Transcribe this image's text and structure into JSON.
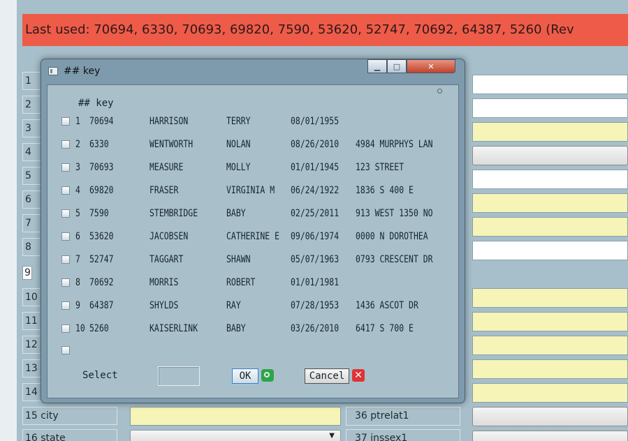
{
  "banner": {
    "text": "Last used: 70694, 6330, 70693, 69820, 7590, 53620, 52747, 70692, 64387, 5260 (Rev"
  },
  "left_rows": [
    "1",
    "2",
    "3",
    "4",
    "5",
    "6",
    "7",
    "8",
    "9",
    "10",
    "11",
    "12",
    "13",
    "14",
    "15 city",
    "16 state"
  ],
  "mid_rows": [
    "36 ptrelat1",
    "37 inssex1"
  ],
  "dialog": {
    "title": "## key",
    "header": "## key",
    "rows": [
      {
        "num": "1",
        "key": "70694",
        "last": "HARRISON",
        "first": "TERRY",
        "dob": "08/01/1955",
        "addr": ""
      },
      {
        "num": "2",
        "key": "6330",
        "last": "WENTWORTH",
        "first": "NOLAN",
        "dob": "08/26/2010",
        "addr": "4984 MURPHYS LAN"
      },
      {
        "num": "3",
        "key": "70693",
        "last": "MEASURE",
        "first": "MOLLY",
        "dob": "01/01/1945",
        "addr": "123 STREET"
      },
      {
        "num": "4",
        "key": "69820",
        "last": "FRASER",
        "first": "VIRGINIA M",
        "dob": "06/24/1922",
        "addr": "1836 S 400 E"
      },
      {
        "num": "5",
        "key": "7590",
        "last": "STEMBRIDGE",
        "first": "BABY",
        "dob": "02/25/2011",
        "addr": "913 WEST 1350 NO"
      },
      {
        "num": "6",
        "key": "53620",
        "last": "JACOBSEN",
        "first": "CATHERINE E",
        "dob": "09/06/1974",
        "addr": "0000 N DOROTHEA"
      },
      {
        "num": "7",
        "key": "52747",
        "last": "TAGGART",
        "first": "SHAWN",
        "dob": "05/07/1963",
        "addr": "0793 CRESCENT DR"
      },
      {
        "num": "8",
        "key": "70692",
        "last": "MORRIS",
        "first": "ROBERT",
        "dob": "01/01/1981",
        "addr": ""
      },
      {
        "num": "9",
        "key": "64387",
        "last": "SHYLDS",
        "first": "RAY",
        "dob": "07/28/1953",
        "addr": "1436 ASCOT DR"
      },
      {
        "num": "10",
        "key": "5260",
        "last": "KAISERLINK",
        "first": "BABY",
        "dob": "03/26/2010",
        "addr": "6417 S 700 E"
      },
      {
        "num": "",
        "key": "",
        "last": "",
        "first": "",
        "dob": "",
        "addr": ""
      }
    ],
    "select_label": "Select",
    "select_value": "",
    "ok_label": "OK",
    "cancel_label": "Cancel",
    "cancel_icon_glyph": "✕"
  }
}
